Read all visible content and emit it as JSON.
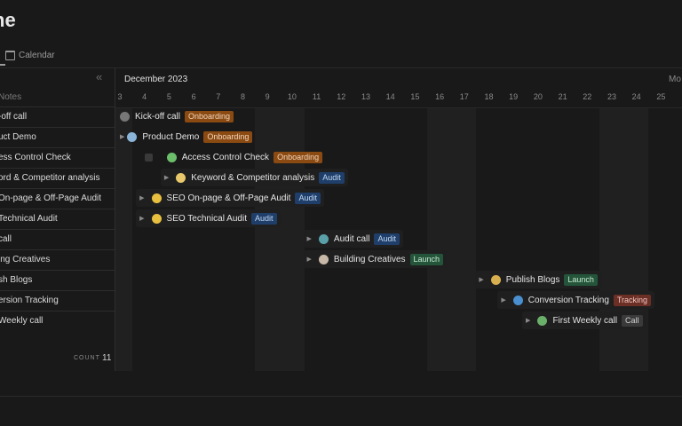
{
  "page": {
    "title_fragment": "ne",
    "view_tab": "Calendar"
  },
  "left_panel": {
    "column_header": "Notes",
    "rows": [
      "-off call",
      "uct Demo",
      "ess Control Check",
      "ord & Competitor analysis",
      "On-page & Off-Page Audit",
      "Technical Audit",
      "call",
      "ing Creatives",
      "sh Blogs",
      "ersion Tracking",
      "Weekly call"
    ],
    "count_label": "COUNT",
    "count_value": "11"
  },
  "timeline": {
    "month": "December 2023",
    "next_month_fragment": "Mo",
    "days": [
      "3",
      "4",
      "5",
      "6",
      "7",
      "8",
      "9",
      "10",
      "11",
      "12",
      "13",
      "14",
      "15",
      "16",
      "17",
      "18",
      "19",
      "20",
      "21",
      "22",
      "23",
      "24",
      "25"
    ],
    "tasks": [
      {
        "name": "Kick-off call",
        "tag": "Onboarding",
        "tag_type": "onboarding",
        "emoji_color": "#777777",
        "expanded": false
      },
      {
        "name": "Product Demo",
        "tag": "Onboarding",
        "tag_type": "onboarding",
        "emoji_color": "#8ab4d8",
        "expanded": false
      },
      {
        "name": "Access Control Check",
        "tag": "Onboarding",
        "tag_type": "onboarding",
        "emoji_color": "#6bbf6a",
        "expanded": false
      },
      {
        "name": "Keyword & Competitor analysis",
        "tag": "Audit",
        "tag_type": "audit",
        "emoji_color": "#e8c86a",
        "expanded": false
      },
      {
        "name": "SEO On-page & Off-Page Audit",
        "tag": "Audit",
        "tag_type": "audit",
        "emoji_color": "#e8c040",
        "expanded": false
      },
      {
        "name": "SEO Technical Audit",
        "tag": "Audit",
        "tag_type": "audit",
        "emoji_color": "#e8c040",
        "expanded": false
      },
      {
        "name": "Audit call",
        "tag": "Audit",
        "tag_type": "audit",
        "emoji_color": "#5aa0a8",
        "expanded": false
      },
      {
        "name": "Building Creatives",
        "tag": "Launch",
        "tag_type": "launch",
        "emoji_color": "#c8b8a8",
        "expanded": false
      },
      {
        "name": "Publish Blogs",
        "tag": "Launch",
        "tag_type": "launch",
        "emoji_color": "#d8b050",
        "expanded": false
      },
      {
        "name": "Conversion Tracking",
        "tag": "Tracking",
        "tag_type": "tracking",
        "emoji_color": "#4a90d0",
        "expanded": false
      },
      {
        "name": "First Weekly call",
        "tag": "Call",
        "tag_type": "call",
        "emoji_color": "#6ab06a",
        "expanded": false
      }
    ]
  }
}
